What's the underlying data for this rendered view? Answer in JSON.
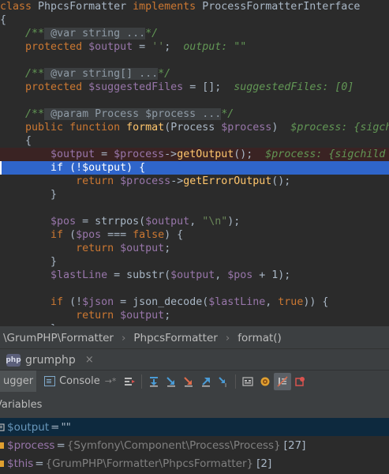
{
  "code": {
    "l1_kw1": "class",
    "l1_cls": " PhpcsFormatter ",
    "l1_kw2": "implements",
    "l1_iface": " ProcessFormatterInterface",
    "l2": "{",
    "l3_open": "/**",
    "l3_tag": " @var string ...",
    "l3_close": "*/",
    "l4_kw": "protected",
    "l4_var": "$output",
    "l4_eq": " = ",
    "l4_str": "''",
    "l4_semi": ";",
    "l4_ann": "output: \"\"",
    "l6_open": "/**",
    "l6_tag": " @var string[] ...",
    "l6_close": "*/",
    "l7_kw": "protected",
    "l7_var": "$suggestedFiles",
    "l7_rest": " = [];",
    "l7_ann": "suggestedFiles: [0]",
    "l9_open": "/**",
    "l9_tag": " @param Process $process ...",
    "l9_close": "*/",
    "l10_kw1": "public",
    "l10_kw2": "function",
    "l10_fn": "format",
    "l10_p1": "(Process ",
    "l10_var": "$process",
    "l10_p2": ")",
    "l10_ann": "$process: {sigchi",
    "l11": "{",
    "l12_var1": "$output",
    "l12_eq": " = ",
    "l12_var2": "$process",
    "l12_arrow": "->",
    "l12_fn": "getOutput",
    "l12_rest": "();",
    "l12_ann": "$process: {sigchild",
    "l13_kw": "if",
    "l13_p1": " (!",
    "l13_var": "$output",
    "l13_p2": ") {",
    "l14_kw": "return",
    "l14_var": "$process",
    "l14_arrow": "->",
    "l14_fn": "getErrorOutput",
    "l14_rest": "();",
    "l15": "}",
    "l17_var": "$pos",
    "l17_a": " = strrpos(",
    "l17_var2": "$output",
    "l17_b": ", ",
    "l17_str": "\"\\n\"",
    "l17_c": ");",
    "l18_kw": "if",
    "l18_a": " (",
    "l18_var": "$pos",
    "l18_b": " === ",
    "l18_kw2": "false",
    "l18_c": ") {",
    "l19_kw": "return",
    "l19_var": "$output",
    "l19_rest": ";",
    "l20": "}",
    "l21_var": "$lastLine",
    "l21_a": " = substr(",
    "l21_var2": "$output",
    "l21_b": ", ",
    "l21_var3": "$pos",
    "l21_c": " + 1);",
    "l23_kw": "if",
    "l23_a": " (!",
    "l23_var": "$json",
    "l23_b": " = json_decode(",
    "l23_var2": "$lastLine",
    "l23_c": ", ",
    "l23_kw2": "true",
    "l23_d": ")) {",
    "l24_kw": "return",
    "l24_var": "$output",
    "l24_rest": ";",
    "l25": "}"
  },
  "breadcrumb": {
    "items": [
      "\\GrumPHP\\Formatter",
      "PhpcsFormatter",
      "format()"
    ],
    "separator": "›"
  },
  "run_tab": {
    "icon_text": "php",
    "label": "grumphp",
    "close": "×"
  },
  "toolbar": {
    "debugger_label": "ugger",
    "console_label": "Console",
    "console_arrow": "→*"
  },
  "variables": {
    "header": "Variables",
    "rows": [
      {
        "name": "$output",
        "eq": " = ",
        "value": "\"\"",
        "type": "",
        "count": ""
      },
      {
        "name": "$process",
        "eq": " = ",
        "value": "",
        "type": "{Symfony\\Component\\Process\\Process}",
        "count": "[27]"
      },
      {
        "name": "$this",
        "eq": " = ",
        "value": "",
        "type": "{GrumPHP\\Formatter\\PhpcsFormatter}",
        "count": "[2]"
      }
    ]
  },
  "colors": {
    "editor_bg": "#2b2b2b",
    "keyword": "#cc7832",
    "variable": "#9876aa",
    "function": "#ffc66d",
    "string": "#6a8759",
    "current_line": "#2f65ca",
    "breakpoint_line": "#3a2323"
  }
}
